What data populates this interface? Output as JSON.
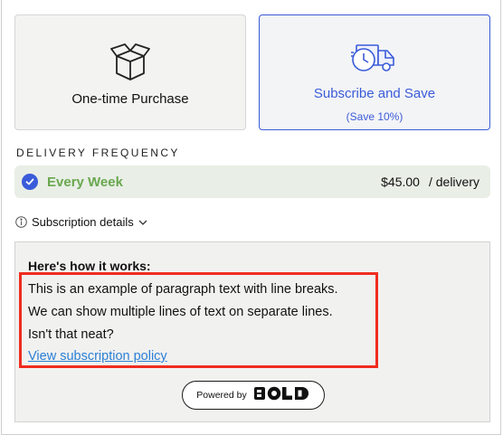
{
  "purchase_options": {
    "one_time": {
      "label": "One-time Purchase",
      "icon": "open-box-icon"
    },
    "subscribe": {
      "label": "Subscribe and Save",
      "sublabel": "(Save 10%)",
      "icon": "delivery-truck-clock-icon",
      "selected": true
    }
  },
  "delivery": {
    "heading": "DELIVERY FREQUENCY",
    "selected_option": {
      "label": "Every Week",
      "price": "$45.00",
      "unit": "/ delivery",
      "icon": "check-circle-icon"
    }
  },
  "subscription_details": {
    "toggle_label": "Subscription details",
    "info_icon": "info-icon",
    "chevron_icon": "chevron-down-icon",
    "how_title": "Here's how it works:",
    "lines": [
      "This is an example of paragraph text with line breaks.",
      "We can show multiple lines of text on separate lines.",
      "Isn't that neat?"
    ],
    "policy_link": "View subscription policy"
  },
  "branding": {
    "powered_by": "Powered by",
    "logo_text": "BOLD"
  },
  "colors": {
    "accent": "#3a5bd9",
    "success_text": "#6aa84f",
    "highlight": "#ef2d1f",
    "link": "#2b7fd6"
  }
}
